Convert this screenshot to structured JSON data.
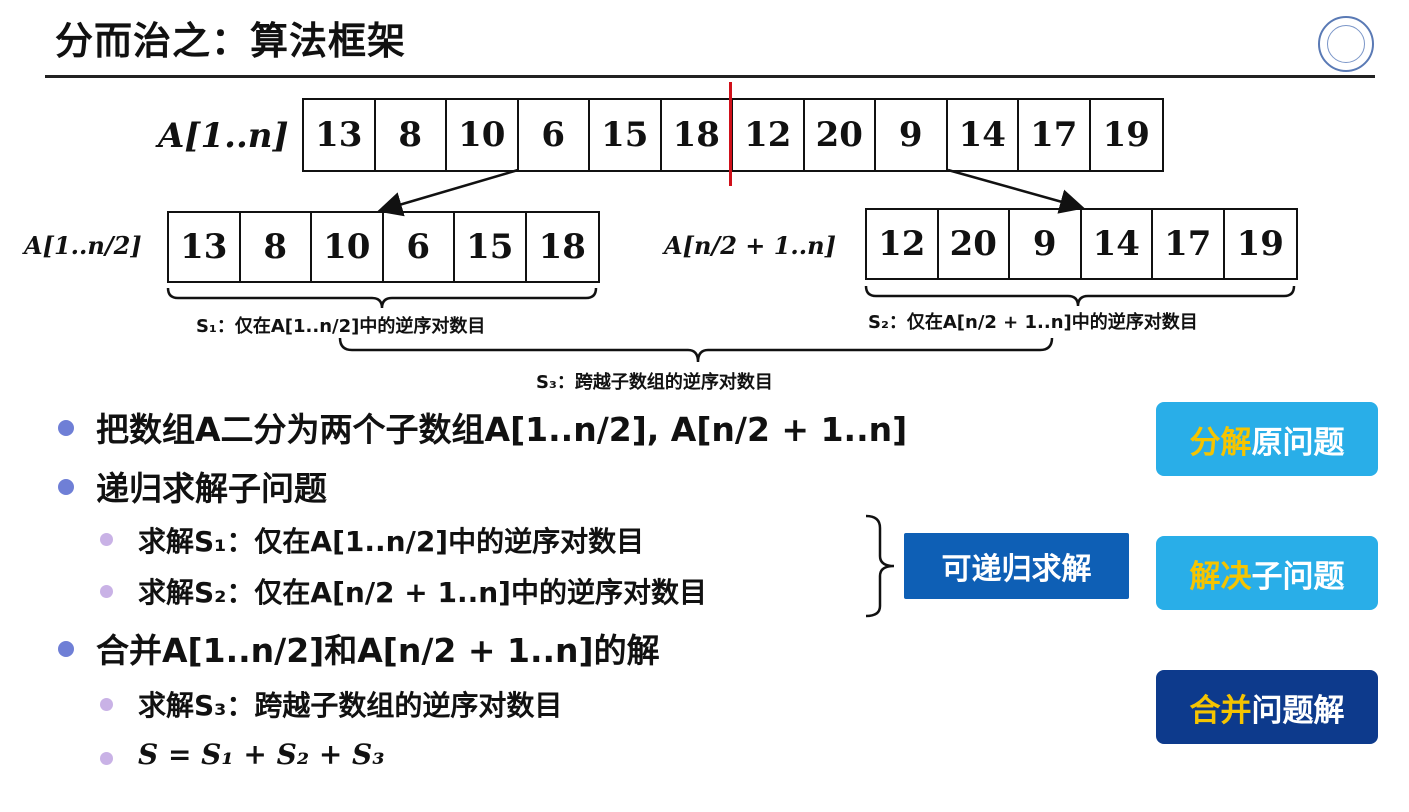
{
  "title": "分而治之：算法框架",
  "main_array": {
    "label": "A[1..n]",
    "values": [
      "13",
      "8",
      "10",
      "6",
      "15",
      "18",
      "12",
      "20",
      "9",
      "14",
      "17",
      "19"
    ]
  },
  "left_array": {
    "label": "A[1..n/2]",
    "values": [
      "13",
      "8",
      "10",
      "6",
      "15",
      "18"
    ]
  },
  "right_array": {
    "label": "A[n/2 + 1..n]",
    "values": [
      "12",
      "20",
      "9",
      "14",
      "17",
      "19"
    ]
  },
  "annotations": {
    "s1": "S₁：仅在A[1..n/2]中的逆序对数目",
    "s2": "S₂：仅在A[n/2 + 1..n]中的逆序对数目",
    "s3": "S₃：跨越子数组的逆序对数目"
  },
  "bullets": {
    "b1": "把数组A二分为两个子数组A[1..n/2], A[n/2 + 1..n]",
    "b2": "递归求解子问题",
    "b2a": "求解S₁：仅在A[1..n/2]中的逆序对数目",
    "b2b": "求解S₂：仅在A[n/2 + 1..n]中的逆序对数目",
    "b3": "合并A[1..n/2]和A[n/2 + 1..n]的解",
    "b3a": "求解S₃：跨越子数组的逆序对数目",
    "b3b": "S = S₁ + S₂ + S₃"
  },
  "buttons": {
    "recursive": "可递归求解",
    "decompose_hl": "分解",
    "decompose_rest": "原问题",
    "solve_hl": "解决",
    "solve_rest": "子问题",
    "merge_hl": "合并",
    "merge_rest": "问题解"
  },
  "colors": {
    "accent_light": "#29aee8",
    "accent_dark": "#0d3a8c",
    "highlight": "#f5c400",
    "divider_red": "#d0101a"
  }
}
